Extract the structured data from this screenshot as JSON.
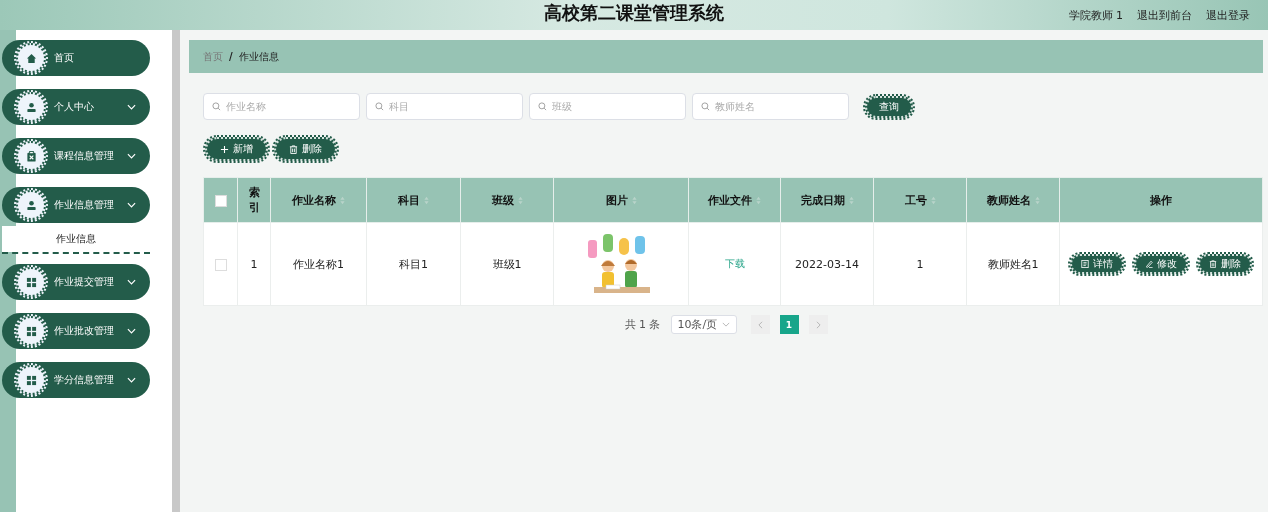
{
  "header": {
    "title": "高校第二课堂管理系统",
    "links": [
      "学院教师 1",
      "退出到前台",
      "退出登录"
    ]
  },
  "sidebar": {
    "items": [
      {
        "label": "首页",
        "has_submenu": false
      },
      {
        "label": "个人中心",
        "has_submenu": true
      },
      {
        "label": "课程信息管理",
        "has_submenu": true
      },
      {
        "label": "作业信息管理",
        "has_submenu": true,
        "children": [
          {
            "label": "作业信息",
            "selected": true
          }
        ]
      },
      {
        "label": "作业提交管理",
        "has_submenu": true
      },
      {
        "label": "作业批改管理",
        "has_submenu": true
      },
      {
        "label": "学分信息管理",
        "has_submenu": true
      }
    ]
  },
  "breadcrumb": {
    "items": [
      "首页",
      "作业信息"
    ],
    "separator": "/"
  },
  "search": {
    "fields": [
      {
        "placeholder": "作业名称"
      },
      {
        "placeholder": "科目"
      },
      {
        "placeholder": "班级"
      },
      {
        "placeholder": "教师姓名"
      }
    ],
    "button": "查询"
  },
  "actions": [
    "新增",
    "删除"
  ],
  "table": {
    "header_checked": false,
    "columns": [
      {
        "label": "索引",
        "sortable": false
      },
      {
        "label": "作业名称",
        "sortable": true
      },
      {
        "label": "科目",
        "sortable": true
      },
      {
        "label": "班级",
        "sortable": true
      },
      {
        "label": "图片",
        "sortable": true
      },
      {
        "label": "作业文件",
        "sortable": true
      },
      {
        "label": "完成日期",
        "sortable": true
      },
      {
        "label": "工号",
        "sortable": true
      },
      {
        "label": "教师姓名",
        "sortable": true
      },
      {
        "label": "操作",
        "sortable": false
      }
    ],
    "rows": [
      {
        "checked": false,
        "index": "1",
        "name": "作业名称1",
        "subject": "科目1",
        "class": "班级1",
        "image": {
          "kind": "picture"
        },
        "file": "下载",
        "date": "2022-03-14",
        "staff_no": "1",
        "teacher": "教师姓名1",
        "actions": [
          "详情",
          "修改",
          "删除"
        ]
      }
    ]
  },
  "pagination": {
    "total": "共 1 条",
    "page_size": "10条/页",
    "pages": [
      {
        "label": "1",
        "selected": true
      }
    ]
  }
}
